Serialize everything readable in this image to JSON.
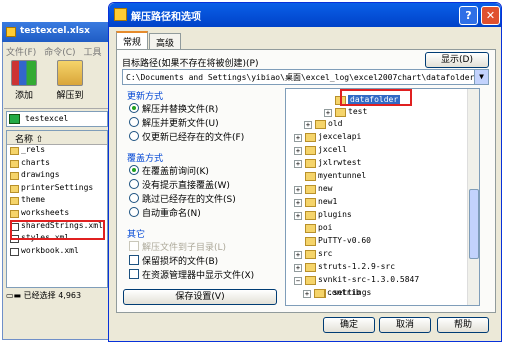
{
  "bg_window": {
    "title": "testexcel.xlsx",
    "menu": [
      "文件(F)",
      "命令(C)",
      "工具"
    ],
    "toolbar": [
      {
        "label": "添加"
      },
      {
        "label": "解压到"
      }
    ],
    "path": "testexcel",
    "column_header": "名称",
    "files": [
      "_rels",
      "charts",
      "drawings",
      "printerSettings",
      "theme",
      "worksheets",
      "sharedStrings.xml",
      "styles.xml",
      "workbook.xml"
    ],
    "status": "已经选择 4,963"
  },
  "dialog": {
    "title": "解压路径和选项",
    "help_btn": "?",
    "close_btn": "✕",
    "tabs": [
      "常规",
      "高级"
    ],
    "target_label": "目标路径(如果不存在将被创建)(P)",
    "show_button": "显示(D)",
    "target_path": "C:\\Documents and Settings\\yibiao\\桌面\\excel_log\\excel2007chart\\datafolder",
    "update_group": "更新方式",
    "update_options": [
      "解压并替换文件(R)",
      "解压并更新文件(U)",
      "仅更新已经存在的文件(F)"
    ],
    "overwrite_group": "覆盖方式",
    "overwrite_options": [
      "在覆盖前询问(K)",
      "没有提示直接覆盖(W)",
      "跳过已经存在的文件(S)",
      "自动重命名(N)"
    ],
    "other_group": "其它",
    "other_options": [
      "解压文件到子目录(L)",
      "保留损坏的文件(B)",
      "在资源管理器中显示文件(X)"
    ],
    "save_button": "保存设置(V)",
    "tree": [
      "datafolder",
      "test",
      "old",
      "jexcelapi",
      "jxcell",
      "jxlrwtest",
      "myentunnel",
      "new",
      "new1",
      "plugins",
      "poi",
      "PuTTY-v0.60",
      "src",
      "struts-1.2.9-src",
      "svnkit-src-1.3.0.5847",
      ".settings",
      "contrib"
    ],
    "ok_button": "确定",
    "cancel_button": "取消",
    "help_button": "帮助"
  }
}
